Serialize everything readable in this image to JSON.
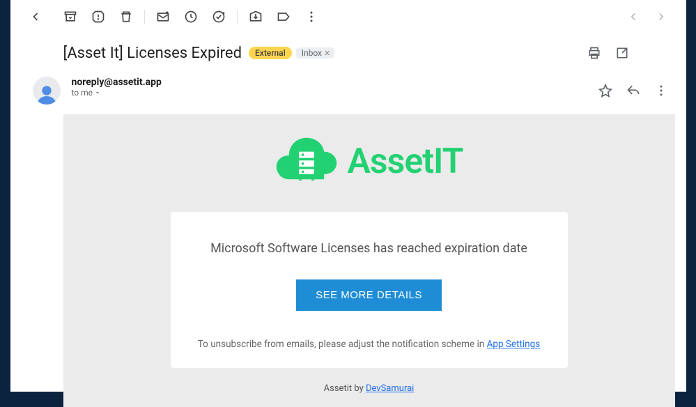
{
  "subject": "[Asset It] Licenses Expired",
  "badges": {
    "external": "External",
    "inbox": "Inbox"
  },
  "sender": {
    "email": "noreply@assetit.app",
    "to_line": "to me"
  },
  "body": {
    "brand_name": "AssetIT",
    "message": "Microsoft Software Licenses has reached expiration date",
    "cta_label": "SEE MORE DETAILS",
    "unsubscribe_prefix": "To unsubscribe from emails, please adjust the notification scheme in ",
    "unsubscribe_link": "App Settings",
    "footer_prefix": "Assetit by ",
    "footer_link": "DevSamurai"
  }
}
